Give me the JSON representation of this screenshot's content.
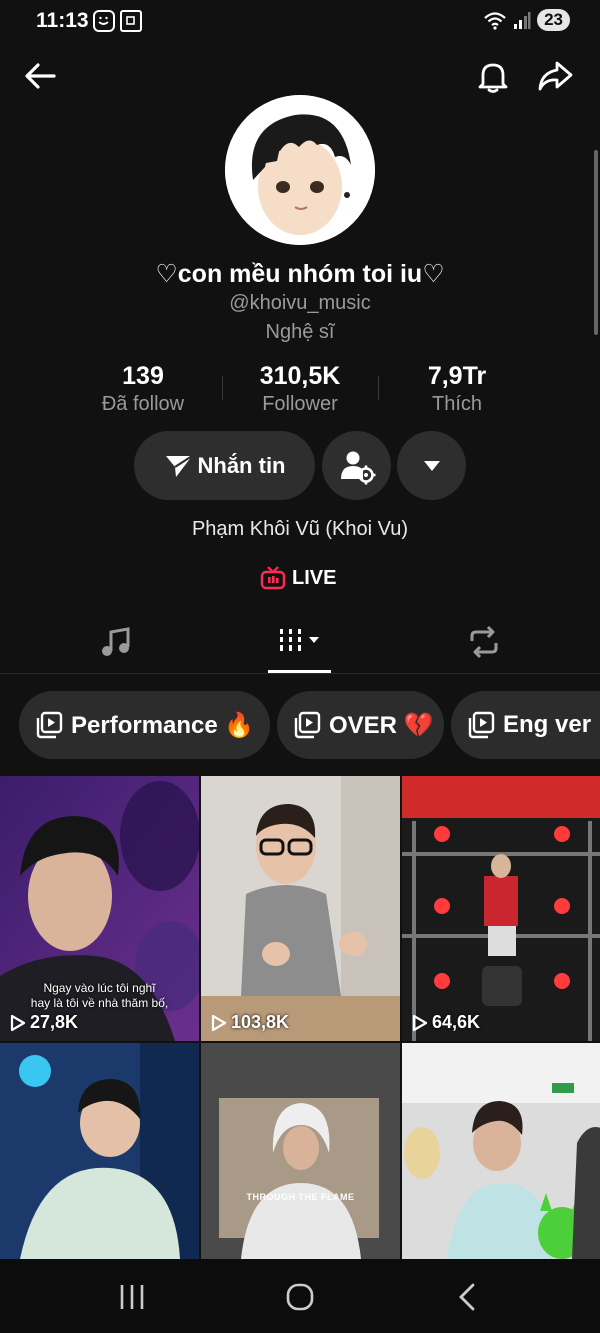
{
  "status_bar": {
    "time": "11:13",
    "battery": "23"
  },
  "header": {
    "back_icon": "arrow-left-icon",
    "notification_icon": "bell-icon",
    "share_icon": "share-arrow-icon"
  },
  "profile": {
    "name": "♡con mều nhóm toi iu♡",
    "handle": "@khoivu_music",
    "category": "Nghệ sĩ",
    "display_name": "Phạm Khôi Vũ (Khoi Vu)"
  },
  "stats": [
    {
      "value": "139",
      "label": "Đã follow"
    },
    {
      "value": "310,5K",
      "label": "Follower"
    },
    {
      "value": "7,9Tr",
      "label": "Thích"
    }
  ],
  "actions": {
    "message_label": "Nhắn tin",
    "message_icon": "send-icon",
    "manage_icon": "user-settings-icon",
    "more_icon": "caret-down-icon"
  },
  "live": {
    "label": "LIVE",
    "icon": "tv-icon",
    "accent": "#fe2c55"
  },
  "tabs": [
    {
      "icon": "music-note-icon"
    },
    {
      "icon": "grid-filter-icon",
      "active": true
    },
    {
      "icon": "repost-icon"
    }
  ],
  "playlists": [
    {
      "label": "Performance 🔥"
    },
    {
      "label": "OVER 💔"
    },
    {
      "label": "Eng ver"
    }
  ],
  "videos": [
    {
      "views": "27,8K",
      "caption_line1": "Ngay vào lúc tôi nghĩ",
      "caption_line2": "hay là tôi về nhà thăm bố,"
    },
    {
      "views": "103,8K"
    },
    {
      "views": "64,6K"
    },
    {},
    {
      "overlay_text": "THROUGH THE FLAME"
    },
    {}
  ],
  "nav": {
    "recents_icon": "recents-icon",
    "home_icon": "home-circle-icon",
    "back_icon": "back-chevron-icon"
  }
}
